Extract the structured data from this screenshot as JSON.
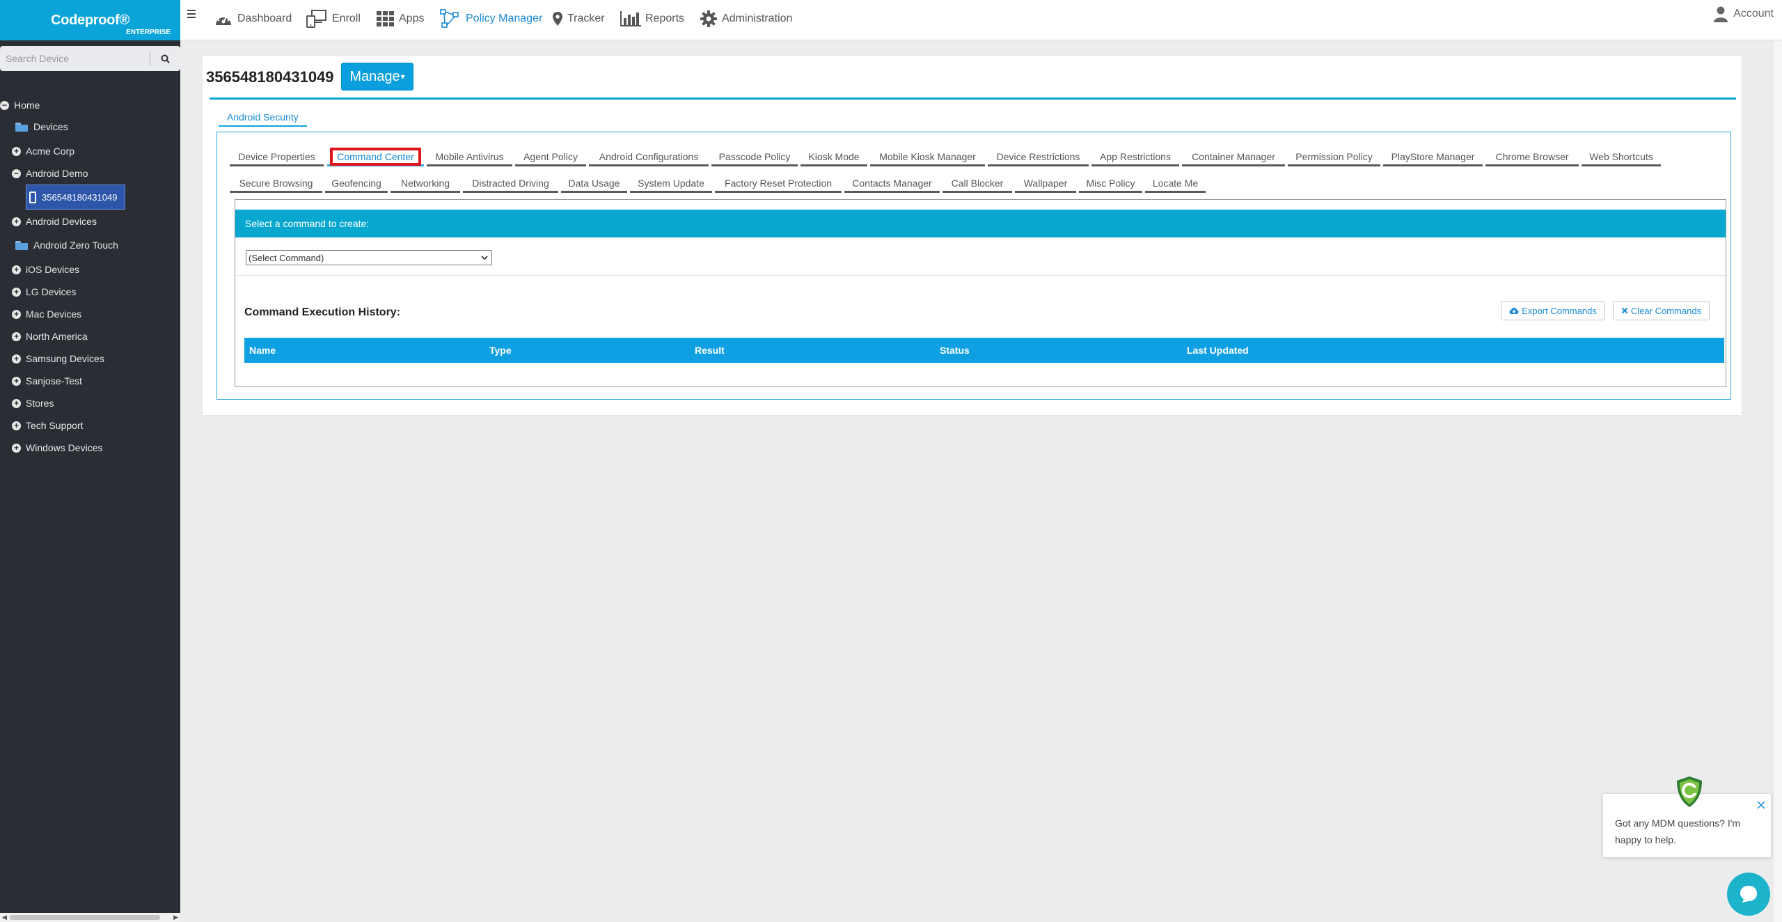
{
  "brand": {
    "name": "Codeproof®",
    "edition": "ENTERPRISE"
  },
  "search": {
    "placeholder": "Search Device"
  },
  "tree": {
    "home": "Home",
    "devices": "Devices",
    "acme": "Acme Corp",
    "android_demo": "Android Demo",
    "selected_device": "356548180431049",
    "android_devices": "Android Devices",
    "android_zero_touch": "Android Zero Touch",
    "ios": "iOS Devices",
    "lg": "LG Devices",
    "mac": "Mac Devices",
    "north_america": "North America",
    "samsung": "Samsung Devices",
    "sanjose": "Sanjose-Test",
    "stores": "Stores",
    "tech_support": "Tech Support",
    "windows": "Windows Devices"
  },
  "nav": {
    "dashboard": "Dashboard",
    "enroll": "Enroll",
    "apps": "Apps",
    "policy_manager": "Policy Manager",
    "tracker": "Tracker",
    "reports": "Reports",
    "administration": "Administration",
    "account": "Account"
  },
  "page": {
    "device_id": "356548180431049",
    "manage_label": "Manage",
    "outer_tab": "Android Security"
  },
  "subtabs": {
    "device_properties": "Device Properties",
    "command_center": "Command Center",
    "mobile_antivirus": "Mobile Antivirus",
    "agent_policy": "Agent Policy",
    "android_configurations": "Android Configurations",
    "passcode_policy": "Passcode Policy",
    "kiosk_mode": "Kiosk Mode",
    "mobile_kiosk_manager": "Mobile Kiosk Manager",
    "device_restrictions": "Device Restrictions",
    "app_restrictions": "App Restrictions",
    "container_manager": "Container Manager",
    "permission_policy": "Permission Policy",
    "playstore_manager": "PlayStore Manager",
    "chrome_browser": "Chrome Browser",
    "web_shortcuts": "Web Shortcuts",
    "secure_browsing": "Secure Browsing",
    "geofencing": "Geofencing",
    "networking": "Networking",
    "distracted_driving": "Distracted Driving",
    "data_usage": "Data Usage",
    "system_update": "System Update",
    "factory_reset_protection": "Factory Reset Protection",
    "contacts_manager": "Contacts Manager",
    "call_blocker": "Call Blocker",
    "wallpaper": "Wallpaper",
    "misc_policy": "Misc Policy",
    "locate_me": "Locate Me"
  },
  "command": {
    "header": "Select a command to create:",
    "select_value": "(Select Command)",
    "history_title": "Command Execution History:",
    "export_label": "Export Commands",
    "clear_label": "Clear Commands",
    "columns": {
      "name": "Name",
      "type": "Type",
      "result": "Result",
      "status": "Status",
      "last_updated": "Last Updated"
    }
  },
  "chat": {
    "message": "Got any MDM questions? I'm happy to help."
  },
  "colors": {
    "brand": "#0aa4d8",
    "sidebar": "#2a2e34",
    "active": "#1a8ad6",
    "table_head": "#0fa0e3",
    "highlight": "#e0141c"
  }
}
